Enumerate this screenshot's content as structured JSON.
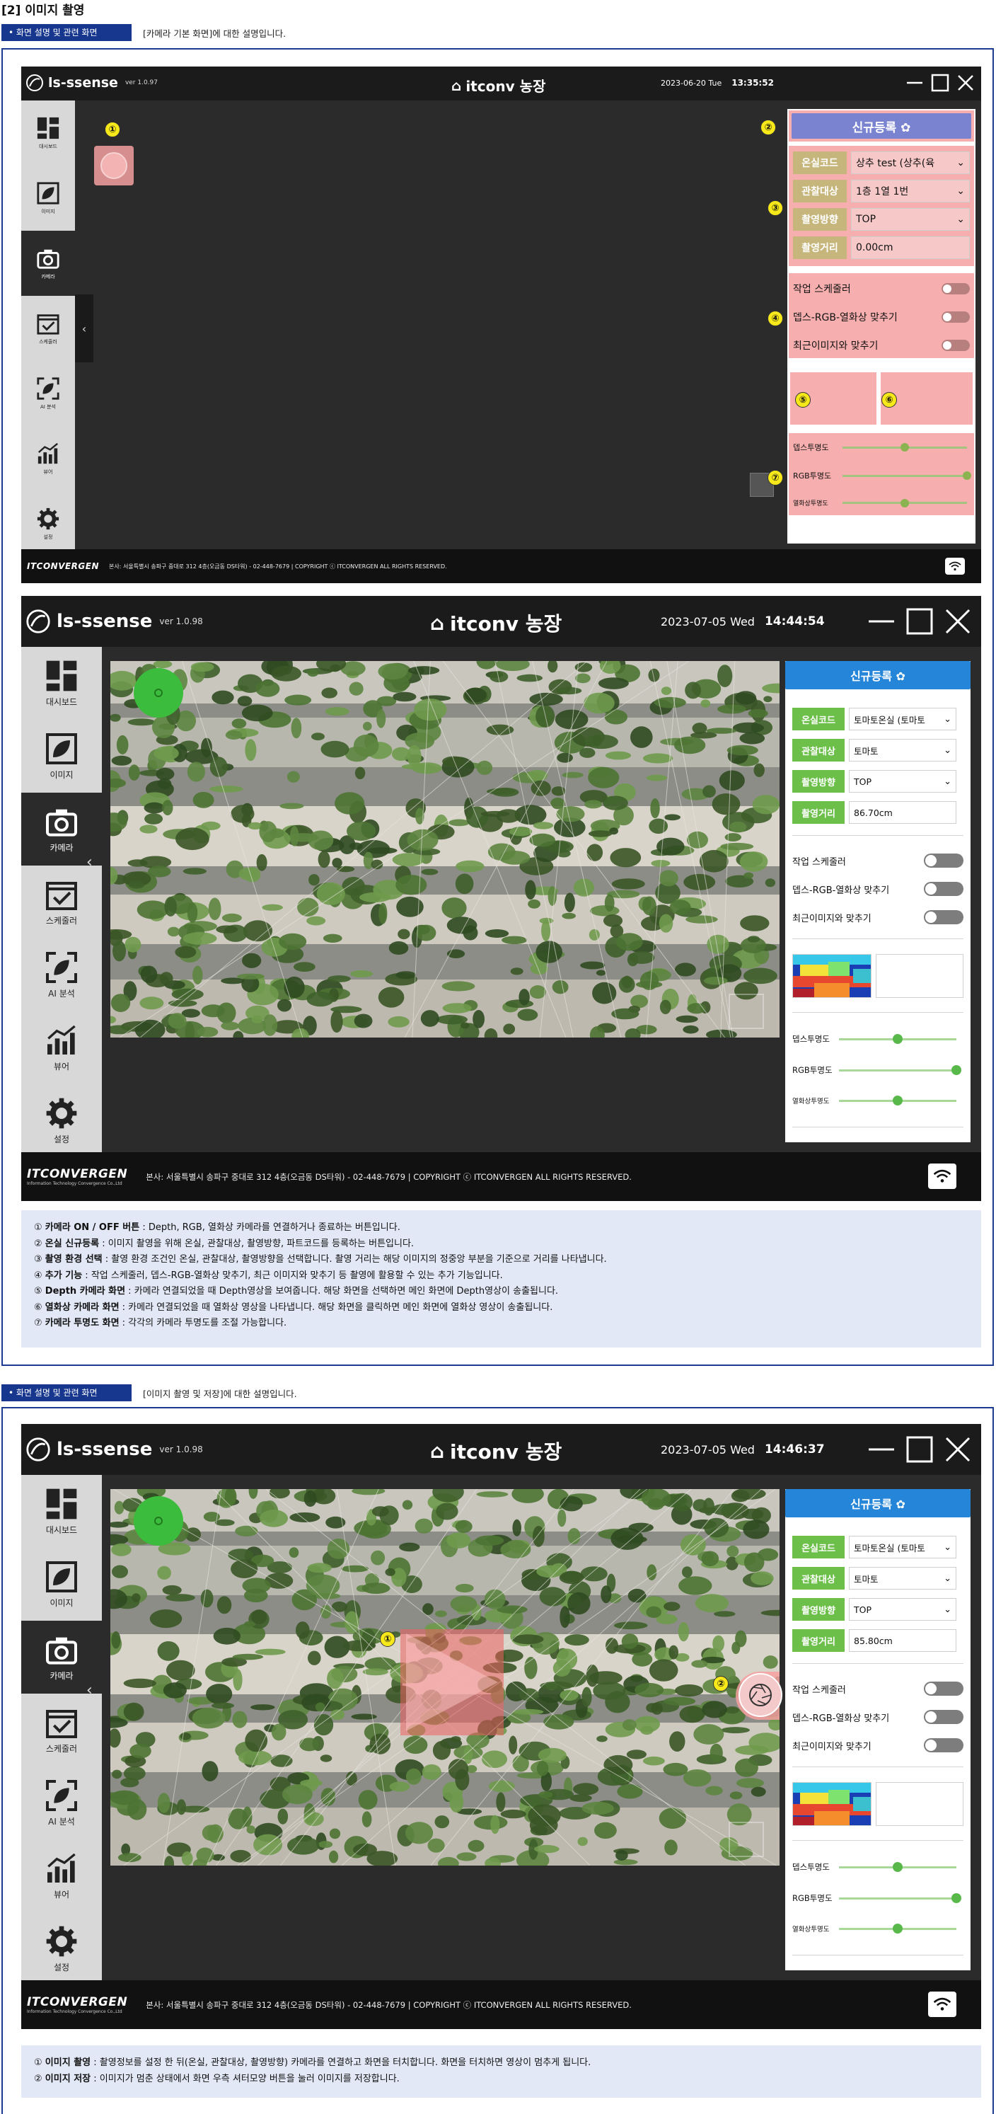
{
  "doc_title": "[2] 이미지 촬영",
  "section1": {
    "tag": "• 화면 설명 및 관련 화면",
    "desc": "[카메라 기본 화면]에 대한 설명입니다."
  },
  "section2": {
    "tag": "• 화면 설명 및 관련 화면",
    "desc": "[이미지 촬영 및 저장]에 대한 설명입니다."
  },
  "app": {
    "logo": "ls-ssense",
    "sidebar": [
      "대시보드",
      "이미지",
      "카메라",
      "스케줄러",
      "AI 분석",
      "뷰어",
      "설정"
    ],
    "footer_brand": "ITCONVERGEN",
    "footer_sub": "Information Technology Convergence Co.,Ltd",
    "footer_addr": "본사: 서울특별시 송파구 중대로 312 4층(오금동 DS타워) - 02-448-7679 | COPYRIGHT ⓒ ITCONVERGEN ALL RIGHTS RESERVED.",
    "reg_button": "신규등록 ✿",
    "labels": {
      "greenhouse": "온실코드",
      "target": "관찰대상",
      "direction": "촬영방향",
      "distance": "촬영거리"
    },
    "toggles": [
      "작업 스케줄러",
      "뎁스-RGB-열화상 맞추기",
      "최근이미지와 맞추기"
    ],
    "sliders": [
      "뎁스투명도",
      "RGB투명도",
      "열화상투명도"
    ]
  },
  "screen1": {
    "farm": "itconv 농장",
    "version": "ver 1.0.97",
    "date": "2023-06-20 Tue",
    "time": "13:35:52",
    "greenhouse": "상추 test (상추(육",
    "target": "1층 1열 1번",
    "direction": "TOP",
    "distance": "0.00cm",
    "markers": [
      "①",
      "②",
      "③",
      "④",
      "⑤",
      "⑥",
      "⑦"
    ],
    "slider_values": [
      0.5,
      1.0,
      0.5
    ]
  },
  "screen2": {
    "farm": "itconv 농장",
    "version": "ver 1.0.98",
    "date": "2023-07-05 Wed",
    "time": "14:44:54",
    "greenhouse": "토마토온실 (토마토",
    "target": "토마토",
    "direction": "TOP",
    "distance": "86.70cm",
    "slider_values": [
      0.5,
      1.0,
      0.5
    ]
  },
  "screen3": {
    "farm": "itconv 농장",
    "version": "ver 1.0.98",
    "date": "2023-07-05 Wed",
    "time": "14:46:37",
    "greenhouse": "토마토온실 (토마토",
    "target": "토마토",
    "direction": "TOP",
    "distance": "85.80cm",
    "markers": [
      "①",
      "②"
    ],
    "slider_values": [
      0.5,
      1.0,
      0.5
    ]
  },
  "desc1": [
    {
      "num": "①",
      "title": "카메라 ON / OFF 버튼",
      "text": " : Depth, RGB, 열화상 카메라를 연결하거나 종료하는 버튼입니다."
    },
    {
      "num": "②",
      "title": "온실 신규등록",
      "text": " : 이미지 촬영을 위해 온실, 관찰대상, 촬영방향, 파트코드를 등록하는 버튼입니다."
    },
    {
      "num": "③",
      "title": "촬영 환경 선택",
      "text": " : 촬영 환경 조건인 온실, 관찰대상, 촬영방향을 선택합니다. 촬영 거리는 해당 이미지의 정중앙 부분을 기준으로 거리를 나타냅니다."
    },
    {
      "num": "④",
      "title": "추가 기능",
      "text": " : 작업 스케줄러, 뎁스-RGB-열화상 맞추기, 최근 이미지와 맞추기 등 촬영에 활용할 수 있는 추가 기능입니다."
    },
    {
      "num": "⑤",
      "title": "Depth 카메라 화면",
      "text": " : 카메라 연결되었을 때 Depth영상을 보여줍니다. 해당 화면을 선택하면 메인 화면에 Depth영상이 송출됩니다."
    },
    {
      "num": "⑥",
      "title": "열화상 카메라 화면",
      "text": " : 카메라 연결되었을 때 열화상 영상을 나타냅니다. 해당 화면을 클릭하면 메인 화면에 열화상 영상이 송출됩니다."
    },
    {
      "num": "⑦",
      "title": "카메라 투명도 화면",
      "text": " : 각각의 카메라 투명도를 조절 가능합니다."
    }
  ],
  "desc2": [
    {
      "num": "①",
      "title": "이미지 촬영",
      "text": " : 촬영정보를 설정 한 뒤(온실, 관찰대상, 촬영방향) 카메라를 연결하고 화면을 터치합니다. 화면을 터치하면 영상이 멈추게 됩니다."
    },
    {
      "num": "②",
      "title": "이미지 저장",
      "text": " : 이미지가 멈춘 상태에서 화면 우측 셔터모양 버튼을 눌러 이미지를 저장합니다."
    }
  ],
  "colors": {
    "accent_blue": "#2585d8",
    "label_green": "#6cc04a",
    "nav_blue": "#17378f"
  },
  "icons": [
    "dashboard-icon",
    "image-leaf-icon",
    "camera-icon",
    "calendar-check-icon",
    "ai-leaf-icon",
    "chart-icon",
    "gear-icon",
    "barn-icon",
    "wifi-icon",
    "minimize-icon",
    "maximize-icon",
    "close-icon",
    "shutter-icon",
    "play-icon"
  ]
}
